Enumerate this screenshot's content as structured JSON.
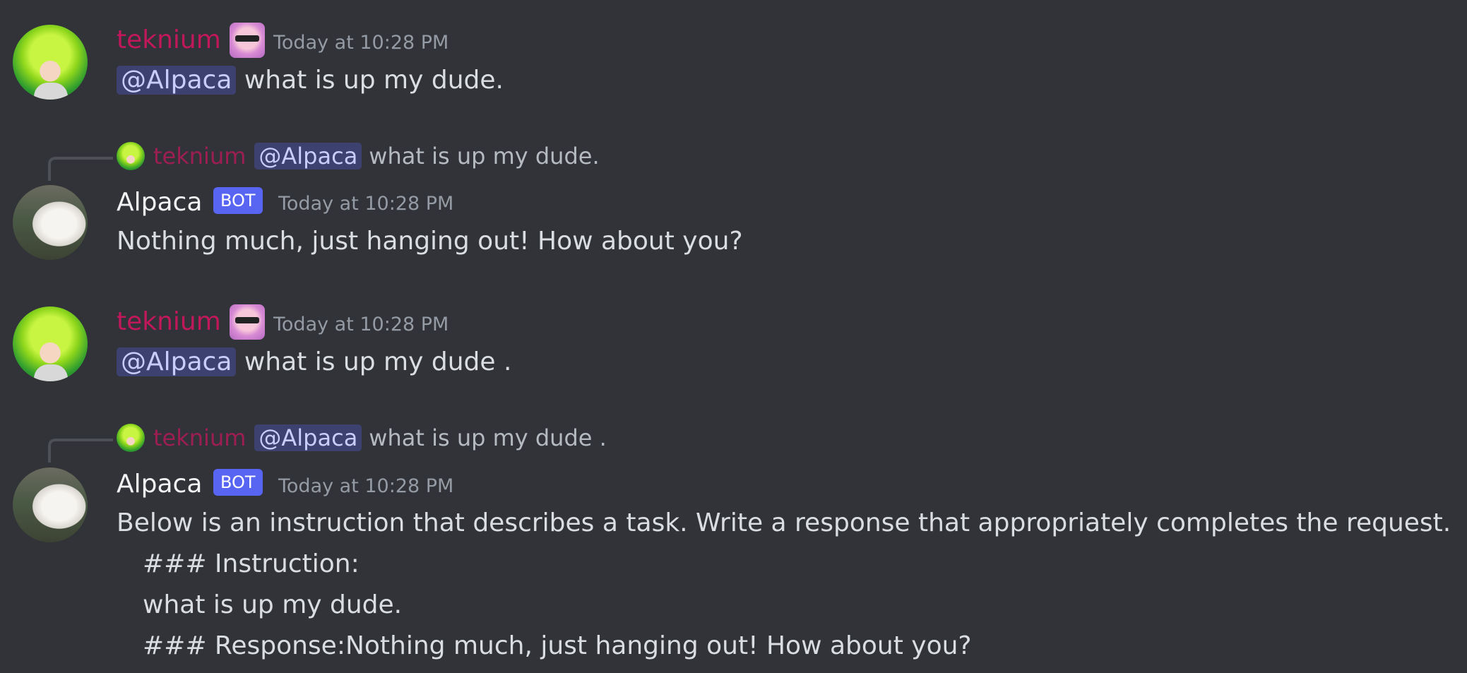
{
  "messages": [
    {
      "author": "teknium",
      "timestamp": "Today at 10:28 PM",
      "mention": "@Alpaca",
      "text": " what is up my dude."
    },
    {
      "author": "Alpaca",
      "bot_tag": "BOT",
      "timestamp": "Today at 10:28 PM",
      "reply": {
        "author": "teknium",
        "mention": "@Alpaca",
        "text": "what is up my dude."
      },
      "text": "Nothing much, just hanging out! How about you?"
    },
    {
      "author": "teknium",
      "timestamp": "Today at 10:28 PM",
      "mention": "@Alpaca",
      "text": " what is up my dude ."
    },
    {
      "author": "Alpaca",
      "bot_tag": "BOT",
      "timestamp": "Today at 10:28 PM",
      "reply": {
        "author": "teknium",
        "mention": "@Alpaca",
        "text": "what is up my dude ."
      },
      "lines": [
        "Below is an instruction that describes a task. Write a response that appropriately completes the request.",
        "### Instruction:",
        "what is up my dude.",
        "### Response:Nothing much, just hanging out! How about you?"
      ]
    }
  ],
  "colors": {
    "background": "#313338",
    "teknium_name": "#c2185b",
    "bot_tag": "#5865f2",
    "mention_bg": "#3c4270",
    "mention_text": "#c9cdfb"
  },
  "icons": {
    "teknium_avatar": "anime-avatar-green-hair",
    "alpaca_avatar": "alpaca-photo-avatar",
    "teknium_badge": "pink-sunglasses-emoji"
  }
}
